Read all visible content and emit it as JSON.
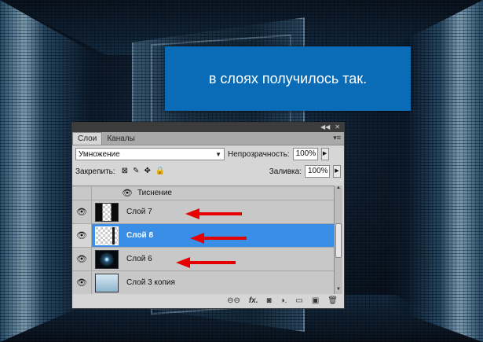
{
  "caption": {
    "text": "в слоях получилось так."
  },
  "panel": {
    "titlebar_icons": [
      "collapse-icon",
      "close-icon"
    ],
    "titlebar_collapse": "◀◀",
    "titlebar_close": "✕",
    "tabs": [
      {
        "label": "Слои",
        "active": true
      },
      {
        "label": "Каналы",
        "active": false
      }
    ],
    "tab_menu_glyph": "▾≡",
    "blend_mode": "Умножение",
    "opacity_label": "Непрозрачность:",
    "opacity_value": "100%",
    "lock_label": "Закрепить:",
    "fill_label": "Заливка:",
    "fill_value": "100%",
    "effect_name": "Тиснение",
    "layers": [
      {
        "name": "Слой 7",
        "visible": true,
        "selected": false,
        "thumb": "t7"
      },
      {
        "name": "Слой 8",
        "visible": true,
        "selected": true,
        "thumb": "t8"
      },
      {
        "name": "Слой 6",
        "visible": true,
        "selected": false,
        "thumb": "t6"
      },
      {
        "name": "Слой 3 копия",
        "visible": true,
        "selected": false,
        "thumb": "t3"
      }
    ],
    "bottom_icons": [
      "link-icon",
      "fx-icon",
      "mask-icon",
      "adjustment-icon",
      "folder-icon",
      "new-layer-icon",
      "trash-icon"
    ],
    "bottom_glyphs": {
      "link": "⊖⊖",
      "fx": "fx.",
      "mask": "◙",
      "adjust": "◑.",
      "folder": "▭",
      "new": "▣",
      "trash": "🗑"
    }
  },
  "colors": {
    "caption_bg": "#0a6cb7",
    "selected_layer": "#3a8ee6",
    "arrow": "#e60000"
  }
}
